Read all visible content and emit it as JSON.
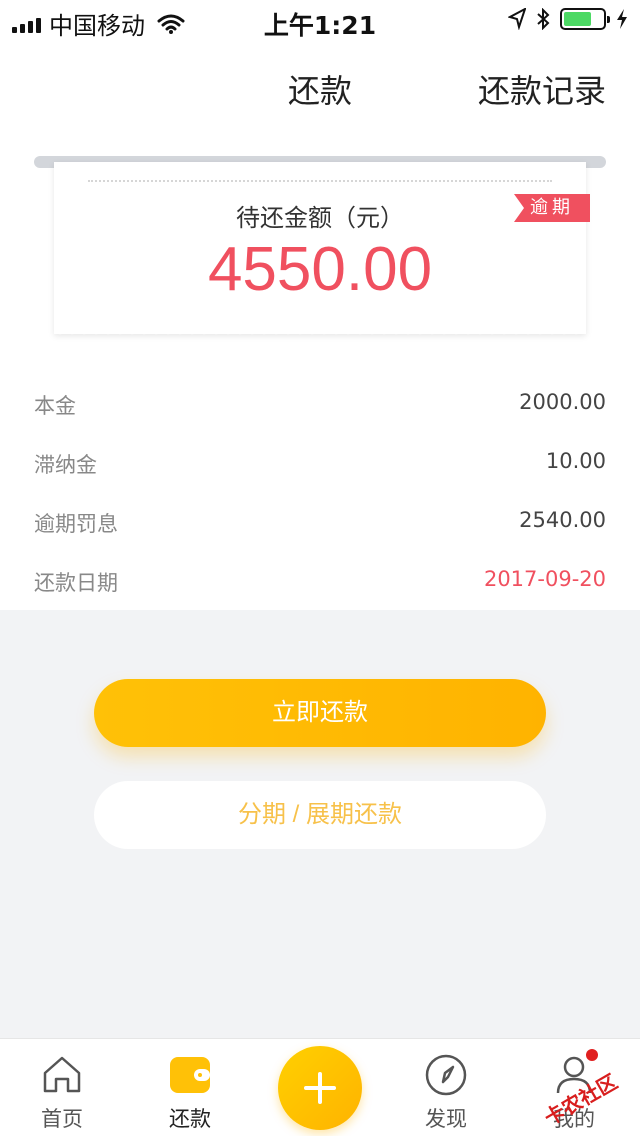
{
  "status_bar": {
    "carrier": "中国移动",
    "time": "上午1:21"
  },
  "nav": {
    "title": "还款",
    "right_link": "还款记录"
  },
  "receipt": {
    "label": "待还金额（元）",
    "amount": "4550.00",
    "tag": "逾期"
  },
  "details": [
    {
      "label": "本金",
      "value": "2000.00"
    },
    {
      "label": "滞纳金",
      "value": "10.00"
    },
    {
      "label": "逾期罚息",
      "value": "2540.00"
    },
    {
      "label": "还款日期",
      "value": "2017-09-20"
    }
  ],
  "actions": {
    "primary": "立即还款",
    "secondary": "分期 / 展期还款"
  },
  "tabs": [
    {
      "label": "首页",
      "icon": "home-icon"
    },
    {
      "label": "还款",
      "icon": "wallet-icon"
    },
    {
      "label": "发现",
      "icon": "compass-icon"
    },
    {
      "label": "我的",
      "icon": "user-icon"
    }
  ],
  "watermark": "卡农社区",
  "colors": {
    "accent": "#ffb300",
    "danger": "#f0505f"
  }
}
